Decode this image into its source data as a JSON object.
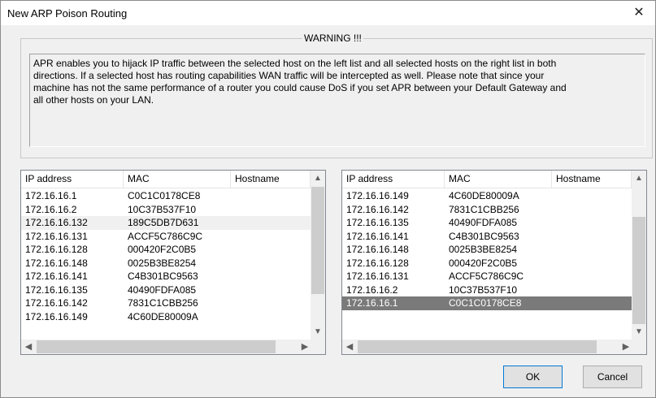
{
  "window": {
    "title": "New ARP Poison Routing",
    "close_glyph": "✕"
  },
  "warning": {
    "legend": "WARNING !!!",
    "lines": [
      "APR enables you to hijack IP traffic between the selected host on the left list and all selected hosts on the right list in both",
      "directions. If a selected host has routing capabilities WAN traffic will be intercepted as well. Please note that since your",
      "machine has not the same performance of a router you could cause DoS if you set APR between your Default Gateway and",
      "all other hosts on your LAN."
    ]
  },
  "columns": {
    "ip": "IP address",
    "mac": "MAC",
    "hostname": "Hostname"
  },
  "left_list": {
    "rows": [
      {
        "ip": "172.16.16.1",
        "mac": "C0C1C0178CE8",
        "hostname": ""
      },
      {
        "ip": "172.16.16.2",
        "mac": "10C37B537F10",
        "hostname": ""
      },
      {
        "ip": "172.16.16.132",
        "mac": "189C5DB7D631",
        "hostname": ""
      },
      {
        "ip": "172.16.16.131",
        "mac": "ACCF5C786C9C",
        "hostname": ""
      },
      {
        "ip": "172.16.16.128",
        "mac": "000420F2C0B5",
        "hostname": ""
      },
      {
        "ip": "172.16.16.148",
        "mac": "0025B3BE8254",
        "hostname": ""
      },
      {
        "ip": "172.16.16.141",
        "mac": "C4B301BC9563",
        "hostname": ""
      },
      {
        "ip": "172.16.16.135",
        "mac": "40490FDFA085",
        "hostname": ""
      },
      {
        "ip": "172.16.16.142",
        "mac": "7831C1CBB256",
        "hostname": ""
      },
      {
        "ip": "172.16.16.149",
        "mac": "4C60DE80009A",
        "hostname": ""
      }
    ],
    "highlighted_row": 2,
    "vscroll_thumb_fraction": {
      "start": 0.0,
      "end": 0.78
    },
    "hscroll_thumb_fraction": {
      "start": 0.0,
      "end": 0.92
    }
  },
  "right_list": {
    "rows": [
      {
        "ip": "172.16.16.149",
        "mac": "4C60DE80009A",
        "hostname": ""
      },
      {
        "ip": "172.16.16.142",
        "mac": "7831C1CBB256",
        "hostname": ""
      },
      {
        "ip": "172.16.16.135",
        "mac": "40490FDFA085",
        "hostname": ""
      },
      {
        "ip": "172.16.16.141",
        "mac": "C4B301BC9563",
        "hostname": ""
      },
      {
        "ip": "172.16.16.148",
        "mac": "0025B3BE8254",
        "hostname": ""
      },
      {
        "ip": "172.16.16.128",
        "mac": "000420F2C0B5",
        "hostname": ""
      },
      {
        "ip": "172.16.16.131",
        "mac": "ACCF5C786C9C",
        "hostname": ""
      },
      {
        "ip": "172.16.16.2",
        "mac": "10C37B537F10",
        "hostname": ""
      },
      {
        "ip": "172.16.16.1",
        "mac": "C0C1C0178CE8",
        "hostname": ""
      }
    ],
    "selected_row": 8,
    "vscroll_thumb_fraction": {
      "start": 0.22,
      "end": 1.0
    },
    "hscroll_thumb_fraction": {
      "start": 0.0,
      "end": 0.92
    }
  },
  "icons": {
    "scroll_up": "▲",
    "scroll_down": "▼",
    "scroll_left": "◀",
    "scroll_right": "▶"
  },
  "buttons": {
    "ok": "OK",
    "cancel": "Cancel"
  },
  "colors": {
    "selected_row_bg": "#7a7a7a",
    "highlight_row_bg": "#f0f0f0",
    "ok_border": "#0078d7"
  }
}
